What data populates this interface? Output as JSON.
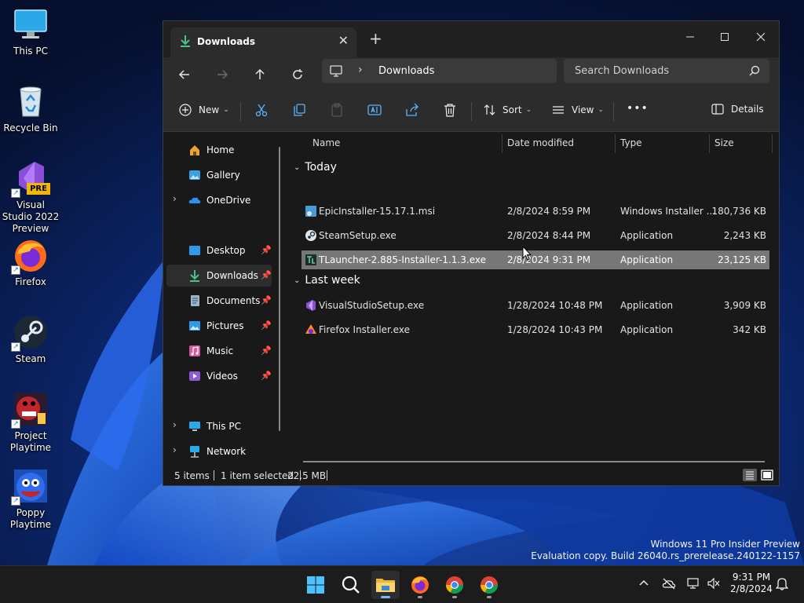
{
  "desktop": {
    "icons": [
      {
        "label": "This PC"
      },
      {
        "label": "Recycle Bin"
      },
      {
        "label": "Visual Studio 2022 Preview",
        "badge": "PRE"
      },
      {
        "label": "Firefox"
      },
      {
        "label": "Steam"
      },
      {
        "label": "Project Playtime"
      },
      {
        "label": "Poppy Playtime"
      }
    ],
    "watermark": {
      "line1": "Windows 11 Pro Insider Preview",
      "line2": "Evaluation copy. Build 26040.rs_prerelease.240122-1157"
    }
  },
  "explorer": {
    "tab_title": "Downloads",
    "address": {
      "crumb": "Downloads"
    },
    "search": {
      "placeholder": "Search Downloads"
    },
    "commandbar": {
      "new_label": "New",
      "sort_label": "Sort",
      "view_label": "View",
      "more_label": "•••",
      "details_label": "Details"
    },
    "nav": {
      "home": "Home",
      "gallery": "Gallery",
      "onedrive": "OneDrive",
      "desktop": "Desktop",
      "downloads": "Downloads",
      "documents": "Documents",
      "pictures": "Pictures",
      "music": "Music",
      "videos": "Videos",
      "thispc": "This PC",
      "network": "Network"
    },
    "columns": {
      "name": "Name",
      "date": "Date modified",
      "type": "Type",
      "size": "Size"
    },
    "groups": {
      "today": {
        "label": "Today",
        "files": [
          {
            "name": "EpicInstaller-15.17.1.msi",
            "date": "2/8/2024 8:59 PM",
            "type": "Windows Installer ...",
            "size": "180,736 KB"
          },
          {
            "name": "SteamSetup.exe",
            "date": "2/8/2024 8:44 PM",
            "type": "Application",
            "size": "2,243 KB"
          },
          {
            "name": "TLauncher-2.885-Installer-1.1.3.exe",
            "date": "2/8/2024 9:31 PM",
            "type": "Application",
            "size": "23,125 KB"
          }
        ]
      },
      "lastweek": {
        "label": "Last week",
        "files": [
          {
            "name": "VisualStudioSetup.exe",
            "date": "1/28/2024 10:48 PM",
            "type": "Application",
            "size": "3,909 KB"
          },
          {
            "name": "Firefox Installer.exe",
            "date": "1/28/2024 10:43 PM",
            "type": "Application",
            "size": "342 KB"
          }
        ]
      }
    },
    "status": {
      "items": "5 items",
      "selected": "1 item selected",
      "size": "22.5 MB"
    }
  },
  "taskbar": {
    "clock": {
      "time": "9:31 PM",
      "date": "2/8/2024"
    }
  },
  "colors": {
    "accent": "#76b9ed",
    "selection": "#777777",
    "window_bg": "#191919"
  }
}
